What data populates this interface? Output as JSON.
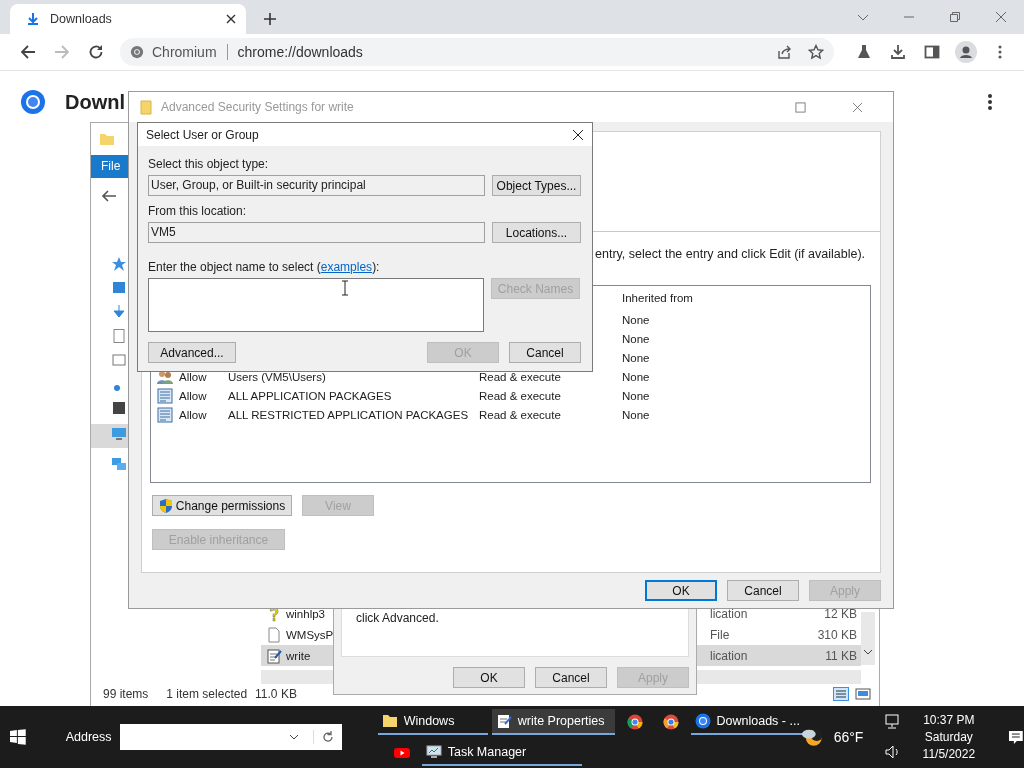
{
  "browser": {
    "tab": {
      "title": "Downloads",
      "selected": true
    },
    "back": {
      "disabled": false
    },
    "forward": {
      "disabled": true
    },
    "address": {
      "site": "Chromium",
      "url": "chrome://downloads"
    },
    "page": {
      "heading": "Downl"
    }
  },
  "explorer": {
    "ribbon_tab": "File",
    "files": [
      {
        "kind": "help",
        "name": "winhlp3",
        "type": "lication",
        "size": "12 KB",
        "selected": false
      },
      {
        "kind": "file",
        "name": "WMSysP",
        "type": "File",
        "size": "310 KB",
        "selected": false
      },
      {
        "kind": "text",
        "name": "write",
        "type": "lication",
        "size": "11 KB",
        "selected": true
      }
    ],
    "status": {
      "count": "99 items",
      "selection": "1 item selected",
      "size": "11.0 KB"
    }
  },
  "properties_dialog": {
    "text": "click Advanced.",
    "buttons": [
      {
        "label": "OK",
        "disabled": false
      },
      {
        "label": "Cancel",
        "disabled": false
      },
      {
        "label": "Apply",
        "disabled": true
      }
    ]
  },
  "advanced_security": {
    "title": "Advanced Security Settings for write",
    "instruction": "entry, select the entry and click Edit (if available).",
    "columns": [
      "Inherited from"
    ],
    "entries": [
      {
        "inherited_from": "None"
      },
      {
        "inherited_from": "None"
      },
      {
        "inherited_from": "None"
      },
      {
        "kind": "users",
        "type": "Allow",
        "principal": "Users (VM5\\Users)",
        "access": "Read & execute",
        "inherited_from": "None"
      },
      {
        "kind": "package",
        "type": "Allow",
        "principal": "ALL APPLICATION PACKAGES",
        "access": "Read & execute",
        "inherited_from": "None"
      },
      {
        "kind": "package",
        "type": "Allow",
        "principal": "ALL RESTRICTED APPLICATION PACKAGES",
        "access": "Read & execute",
        "inherited_from": "None"
      }
    ],
    "actions": [
      {
        "kind": "shield",
        "label": "Change permissions",
        "disabled": false
      },
      {
        "kind": "plain",
        "label": "View",
        "disabled": true
      },
      {
        "kind": "plain",
        "label": "Enable inheritance",
        "disabled": true
      }
    ],
    "buttons": [
      {
        "label": "OK",
        "disabled": false,
        "default": true
      },
      {
        "label": "Cancel",
        "disabled": false,
        "default": false
      },
      {
        "label": "Apply",
        "disabled": true,
        "default": false
      }
    ]
  },
  "select_dialog": {
    "title": "Select User or Group",
    "object_type_label": "Select this object type:",
    "object_type": "User, Group, or Built-in security principal",
    "object_types_button": "Object Types...",
    "location_label": "From this location:",
    "location": "VM5",
    "locations_button": "Locations...",
    "name_label": {
      "before": "Enter the object name to select (",
      "link": "examples",
      "after": "):"
    },
    "check_names": {
      "label": "Check Names",
      "disabled": true
    },
    "advanced_button": "Advanced...",
    "buttons": [
      {
        "label": "OK",
        "disabled": true
      },
      {
        "label": "Cancel",
        "disabled": false
      }
    ]
  },
  "taskbar": {
    "address_label": "Address",
    "rows": [
      [
        {
          "kind": "folder",
          "label": "Windows",
          "active": false
        },
        {
          "kind": "notepad",
          "label": "write Properties",
          "active": true
        },
        {
          "kind": "chrome",
          "active": false
        },
        {
          "kind": "chromium-alt",
          "active": false
        },
        {
          "kind": "chromium",
          "label": "Downloads - ...",
          "active": false
        }
      ],
      [
        {
          "kind": "youtube",
          "active": false
        },
        {
          "kind": "monitor",
          "label": "Task Manager",
          "active": false
        }
      ]
    ],
    "temperature": "66°F",
    "time": "10:37 PM",
    "day": "Saturday",
    "date": "11/5/2022"
  }
}
